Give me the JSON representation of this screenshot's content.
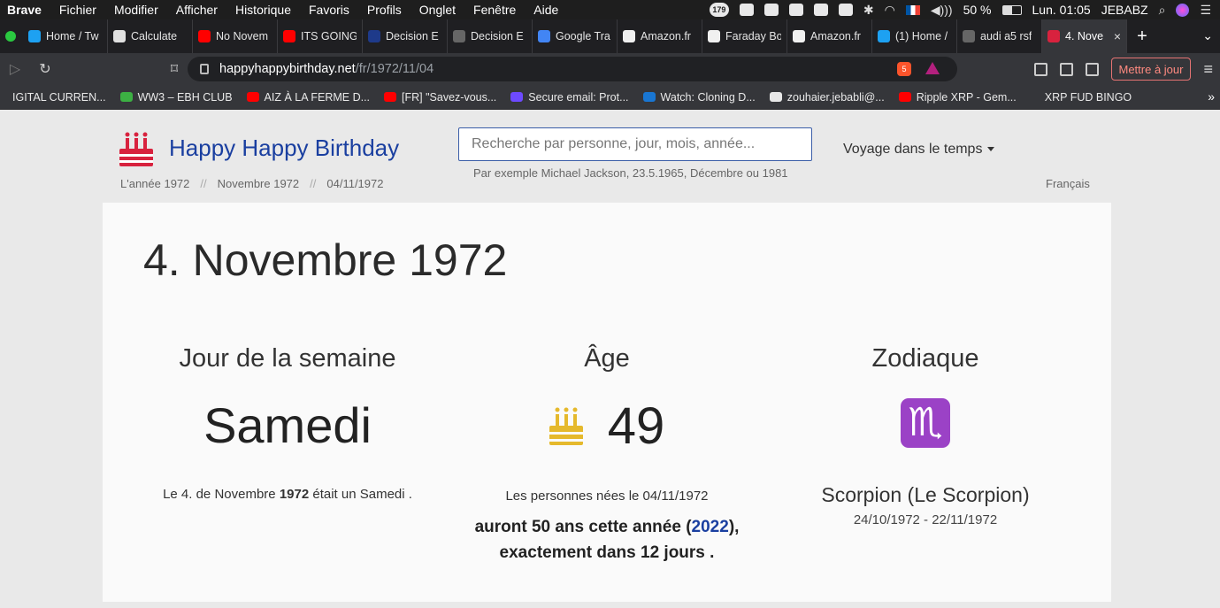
{
  "menubar": {
    "app": "Brave",
    "items": [
      "Fichier",
      "Modifier",
      "Afficher",
      "Historique",
      "Favoris",
      "Profils",
      "Onglet",
      "Fenêtre",
      "Aide"
    ],
    "notif_badge": "179",
    "battery": "50 %",
    "clock": "Lun. 01:05",
    "user": "JEBABZ"
  },
  "tabs": [
    {
      "label": "Home / Tw",
      "color": "#1da1f2",
      "icon": "twitter-icon"
    },
    {
      "label": "Calculate",
      "color": "#e0e0e0",
      "icon": "calculator-icon"
    },
    {
      "label": "No Novem",
      "color": "#ff0000",
      "icon": "youtube-icon"
    },
    {
      "label": "ITS GOING",
      "color": "#ff0000",
      "icon": "youtube-icon"
    },
    {
      "label": "Decision E",
      "color": "#1e3a8a",
      "icon": "site-icon"
    },
    {
      "label": "Decision E",
      "color": "#666666",
      "icon": "globe-icon"
    },
    {
      "label": "Google Tra",
      "color": "#4285f4",
      "icon": "google-translate-icon"
    },
    {
      "label": "Amazon.fr",
      "color": "#f0f0f0",
      "icon": "amazon-icon"
    },
    {
      "label": "Faraday Bo",
      "color": "#f0f0f0",
      "icon": "amazon-icon"
    },
    {
      "label": "Amazon.fr",
      "color": "#f0f0f0",
      "icon": "amazon-icon"
    },
    {
      "label": "(1) Home /",
      "color": "#1da1f2",
      "icon": "twitter-icon"
    },
    {
      "label": "audi a5 rsf",
      "color": "#666666",
      "icon": "globe-icon"
    },
    {
      "label": "4. Nove",
      "color": "#d8223e",
      "icon": "cake-icon",
      "active": true
    }
  ],
  "address": {
    "host": "happyhappybirthday.net",
    "path": "/fr/1972/11/04",
    "shield_count": "5",
    "update_label": "Mettre à jour"
  },
  "bookmarks": [
    {
      "label": "IGITAL CURREN...",
      "color": "transparent"
    },
    {
      "label": "WW3 – EBH CLUB",
      "color": "#3cb043"
    },
    {
      "label": "AIZ À LA FERME D...",
      "color": "#ff0000"
    },
    {
      "label": "[FR] \"Savez-vous...",
      "color": "#ff0000"
    },
    {
      "label": "Secure email: Prot...",
      "color": "#6d4aff"
    },
    {
      "label": "Watch: Cloning D...",
      "color": "#1976d2"
    },
    {
      "label": "zouhaier.jebabli@...",
      "color": "#e8e8e8"
    },
    {
      "label": "Ripple XRP - Gem...",
      "color": "#ff0000"
    },
    {
      "label": "XRP FUD BINGO",
      "color": "transparent"
    }
  ],
  "site": {
    "brand": "Happy Happy Birthday",
    "search_placeholder": "Recherche par personne, jour, mois, année...",
    "search_hint": "Par exemple Michael Jackson, 23.5.1965, Décembre ou 1981",
    "time_travel": "Voyage dans le temps",
    "breadcrumbs": [
      "L'année 1972",
      "Novembre 1972",
      "04/11/1972"
    ],
    "language": "Français"
  },
  "main": {
    "title": "4. Novembre 1972",
    "weekday": {
      "heading": "Jour de la semaine",
      "value": "Samedi",
      "sentence_pre": "Le 4. de Novembre ",
      "sentence_year": "1972",
      "sentence_post": " était un Samedi ."
    },
    "age": {
      "heading": "Âge",
      "value": "49",
      "sub": "Les personnes nées le 04/11/1972",
      "strong_pre": "auront 50 ans cette année (",
      "strong_year": "2022",
      "strong_post": "),",
      "strong_line2": "exactement dans 12 jours ."
    },
    "zodiac": {
      "heading": "Zodiaque",
      "symbol": "♏",
      "name": "Scorpion (Le Scorpion)",
      "range": "24/10/1972 - 22/11/1972"
    }
  }
}
